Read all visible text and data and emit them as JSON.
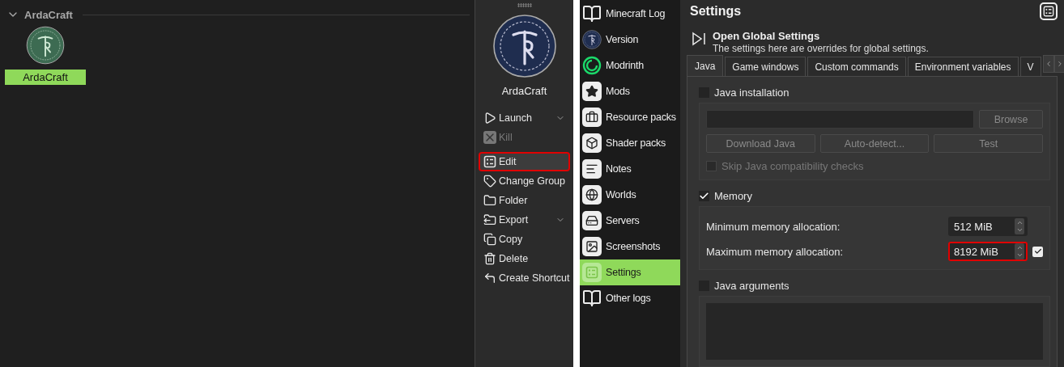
{
  "instances": {
    "group": {
      "name": "ArdaCraft",
      "expanded": true
    },
    "items": [
      {
        "name": "ArdaCraft",
        "selected": true
      }
    ]
  },
  "instance_panel": {
    "name": "ArdaCraft",
    "actions": [
      {
        "label": "Launch",
        "disabled": false,
        "menu": true,
        "highlighted": false
      },
      {
        "label": "Kill",
        "disabled": true,
        "menu": false,
        "highlighted": false
      },
      {
        "label": "Edit",
        "disabled": false,
        "menu": false,
        "highlighted": true
      },
      {
        "label": "Change Group",
        "disabled": false,
        "menu": false,
        "highlighted": false
      },
      {
        "label": "Folder",
        "disabled": false,
        "menu": false,
        "highlighted": false
      },
      {
        "label": "Export",
        "disabled": false,
        "menu": true,
        "highlighted": false
      },
      {
        "label": "Copy",
        "disabled": false,
        "menu": false,
        "highlighted": false
      },
      {
        "label": "Delete",
        "disabled": false,
        "menu": false,
        "highlighted": false
      },
      {
        "label": "Create Shortcut",
        "disabled": false,
        "menu": false,
        "highlighted": false
      }
    ]
  },
  "settings": {
    "nav": [
      {
        "label": "Minecraft Log",
        "selected": false
      },
      {
        "label": "Version",
        "selected": false
      },
      {
        "label": "Modrinth",
        "selected": false
      },
      {
        "label": "Mods",
        "selected": false
      },
      {
        "label": "Resource packs",
        "selected": false
      },
      {
        "label": "Shader packs",
        "selected": false
      },
      {
        "label": "Notes",
        "selected": false
      },
      {
        "label": "Worlds",
        "selected": false
      },
      {
        "label": "Servers",
        "selected": false
      },
      {
        "label": "Screenshots",
        "selected": false
      },
      {
        "label": "Settings",
        "selected": true
      },
      {
        "label": "Other logs",
        "selected": false
      }
    ],
    "title": "Settings",
    "global": {
      "title": "Open Global Settings",
      "description": "The settings here are overrides for global settings."
    },
    "tabs": [
      {
        "label": "Java",
        "selected": true
      },
      {
        "label": "Game windows",
        "selected": false
      },
      {
        "label": "Custom commands",
        "selected": false
      },
      {
        "label": "Environment variables",
        "selected": false
      },
      {
        "label": "V",
        "selected": false
      }
    ],
    "java_installation": {
      "label": "Java installation",
      "checked": false,
      "buttons": [
        {
          "label": "Browse",
          "disabled": true
        },
        {
          "label": "Download Java",
          "disabled": true
        },
        {
          "label": "Auto-detect...",
          "disabled": true
        },
        {
          "label": "Test",
          "disabled": true
        }
      ],
      "skip_check": {
        "label": "Skip Java compatibility checks",
        "checked": false,
        "disabled": true
      }
    },
    "memory": {
      "label": "Memory",
      "checked": true,
      "rows": [
        {
          "label": "Minimum memory allocation:",
          "value": "512 MiB",
          "highlighted": false,
          "confirmed": false
        },
        {
          "label": "Maximum memory allocation:",
          "value": "8192 MiB",
          "highlighted": true,
          "confirmed": true
        }
      ]
    },
    "java_arguments": {
      "label": "Java arguments",
      "checked": false
    }
  }
}
